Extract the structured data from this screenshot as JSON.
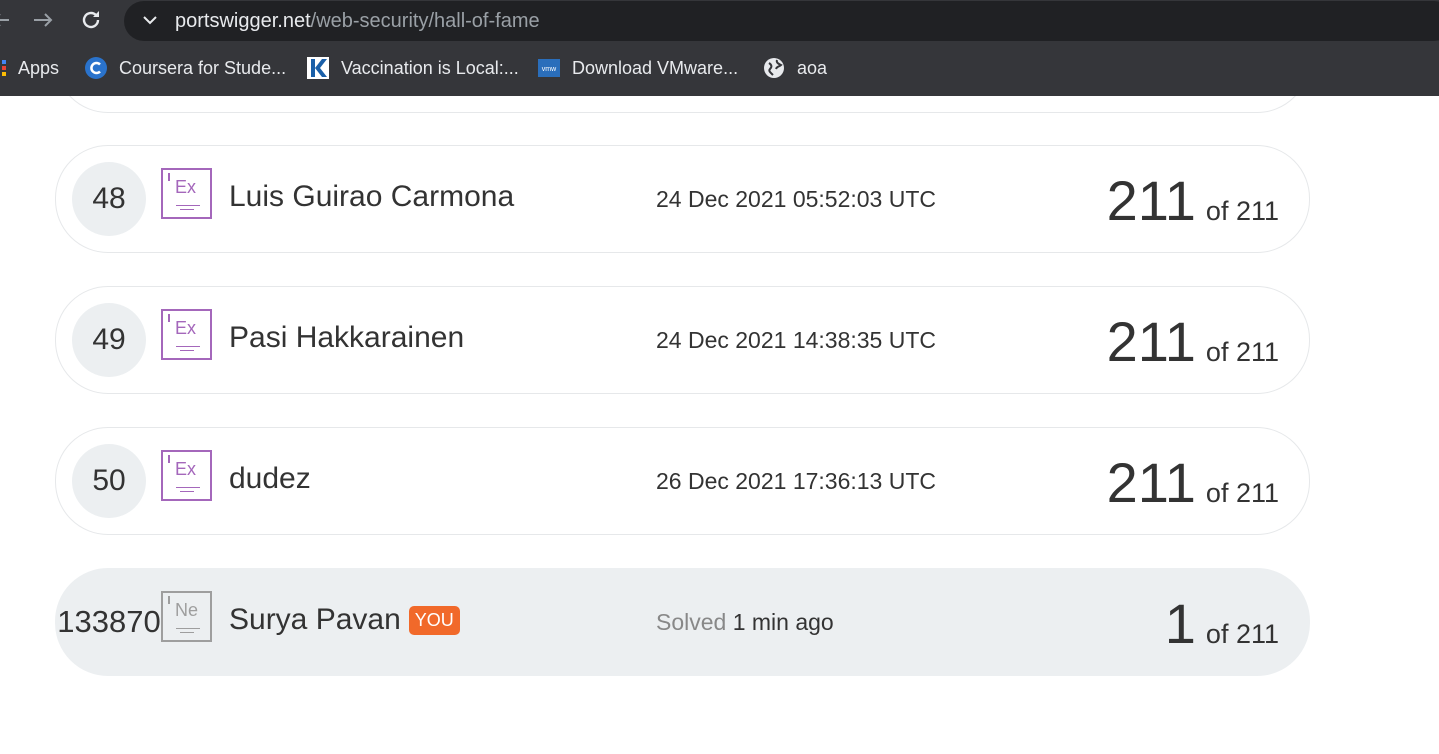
{
  "browser": {
    "url_host": "portswigger.net",
    "url_path": "/web-security/hall-of-fame",
    "bookmarks": [
      {
        "label": "Apps",
        "icon": "apps-grid-icon"
      },
      {
        "label": "Coursera for Stude...",
        "icon": "coursera-icon"
      },
      {
        "label": "Vaccination is Local:...",
        "icon": "k-logo-icon"
      },
      {
        "label": "Download VMware...",
        "icon": "vmware-icon"
      },
      {
        "label": "aoa",
        "icon": "globe-icon"
      }
    ]
  },
  "leaderboard": {
    "rows": [
      {
        "rank": "48",
        "element": "Ex",
        "name": "Luis Guirao Carmona",
        "date": "24 Dec 2021 05:52:03 UTC",
        "solved": "211",
        "of_total": "of 211"
      },
      {
        "rank": "49",
        "element": "Ex",
        "name": "Pasi Hakkarainen",
        "date": "24 Dec 2021 14:38:35 UTC",
        "solved": "211",
        "of_total": "of 211"
      },
      {
        "rank": "50",
        "element": "Ex",
        "name": "dudez",
        "date": "26 Dec 2021 17:36:13 UTC",
        "solved": "211",
        "of_total": "of 211"
      }
    ],
    "you": {
      "rank": "133870",
      "element": "Ne",
      "name": "Surya Pavan",
      "badge": "YOU",
      "status_label": "Solved",
      "status_time": "1 min ago",
      "solved": "1",
      "of_total": "of 211"
    }
  },
  "colors": {
    "expert": "#a467bb",
    "newbie": "#9e9e9e",
    "badge": "#f1692a",
    "you_bg": "#eceff1"
  }
}
